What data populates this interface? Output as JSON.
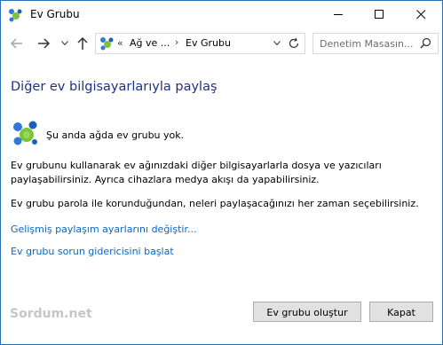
{
  "window": {
    "title": "Ev Grubu",
    "controls": [
      "minimize-icon",
      "maximize-icon",
      "close-icon"
    ]
  },
  "addressbar": {
    "chevron": "«",
    "segment1": "Ağ ve ...",
    "separator": "›",
    "segment2": "Ev Grubu"
  },
  "search": {
    "placeholder": "Denetim Masasın..."
  },
  "content": {
    "heading": "Diğer ev bilgisayarlarıyla paylaş",
    "status": "Şu anda ağda ev grubu yok.",
    "paragraph1": "Ev grubunu kullanarak ev ağınızdaki diğer bilgisayarlarla dosya ve yazıcıları paylaşabilirsiniz. Ayrıca cihazlara medya akışı da yapabilirsiniz.",
    "paragraph2": "Ev grubu parola ile korunduğundan, neleri paylaşacağınızı her zaman seçebilirsiniz.",
    "link_advanced": "Gelişmiş paylaşım ayarlarını değiştir...",
    "link_troubleshoot": "Ev grubu sorun gidericisini başlat"
  },
  "footer": {
    "watermark": "Sordum.net",
    "create_button": "Ev grubu oluştur",
    "close_button": "Kapat"
  },
  "colors": {
    "heading": "#1e3287",
    "link": "#0a66c2",
    "window_border": "#2a6fb3"
  }
}
